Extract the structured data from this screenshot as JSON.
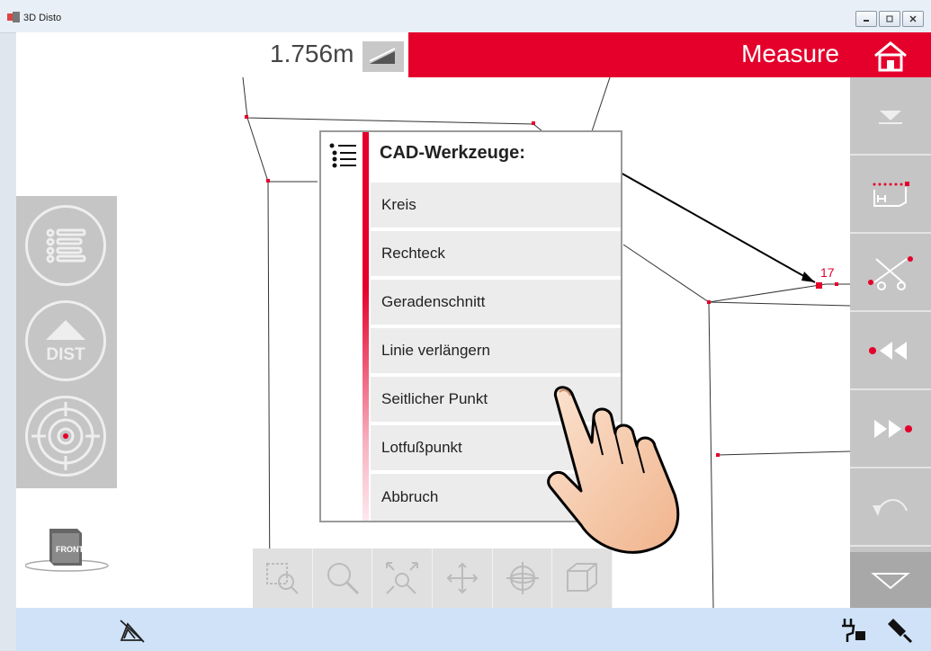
{
  "window": {
    "title": "3D Disto"
  },
  "header": {
    "distance": "1.756m",
    "mode": "Measure"
  },
  "canvas": {
    "point_label": "17"
  },
  "left_panel": {
    "dist_label": "DIST"
  },
  "cube": {
    "label": "FRONT"
  },
  "menu": {
    "title": "CAD-Werkzeuge:",
    "items": [
      {
        "label": "Kreis"
      },
      {
        "label": "Rechteck"
      },
      {
        "label": "Geradenschnitt"
      },
      {
        "label": "Linie verlängern"
      },
      {
        "label": "Seitlicher Punkt"
      },
      {
        "label": "Lotfußpunkt"
      },
      {
        "label": "Abbruch"
      }
    ]
  },
  "colors": {
    "accent": "#e4002b",
    "panel": "#c5c5c5",
    "status": "#cfe2f8"
  },
  "icons": {
    "toolbar": [
      "zoom-window-icon",
      "zoom-icon",
      "zoom-extents-icon",
      "pan-icon",
      "orbit-icon",
      "3d-view-icon"
    ],
    "right": [
      "dropdown-icon",
      "cad-tools-icon",
      "scissors-icon",
      "previous-point-icon",
      "next-point-icon",
      "undo-icon",
      "expand-icon"
    ]
  }
}
